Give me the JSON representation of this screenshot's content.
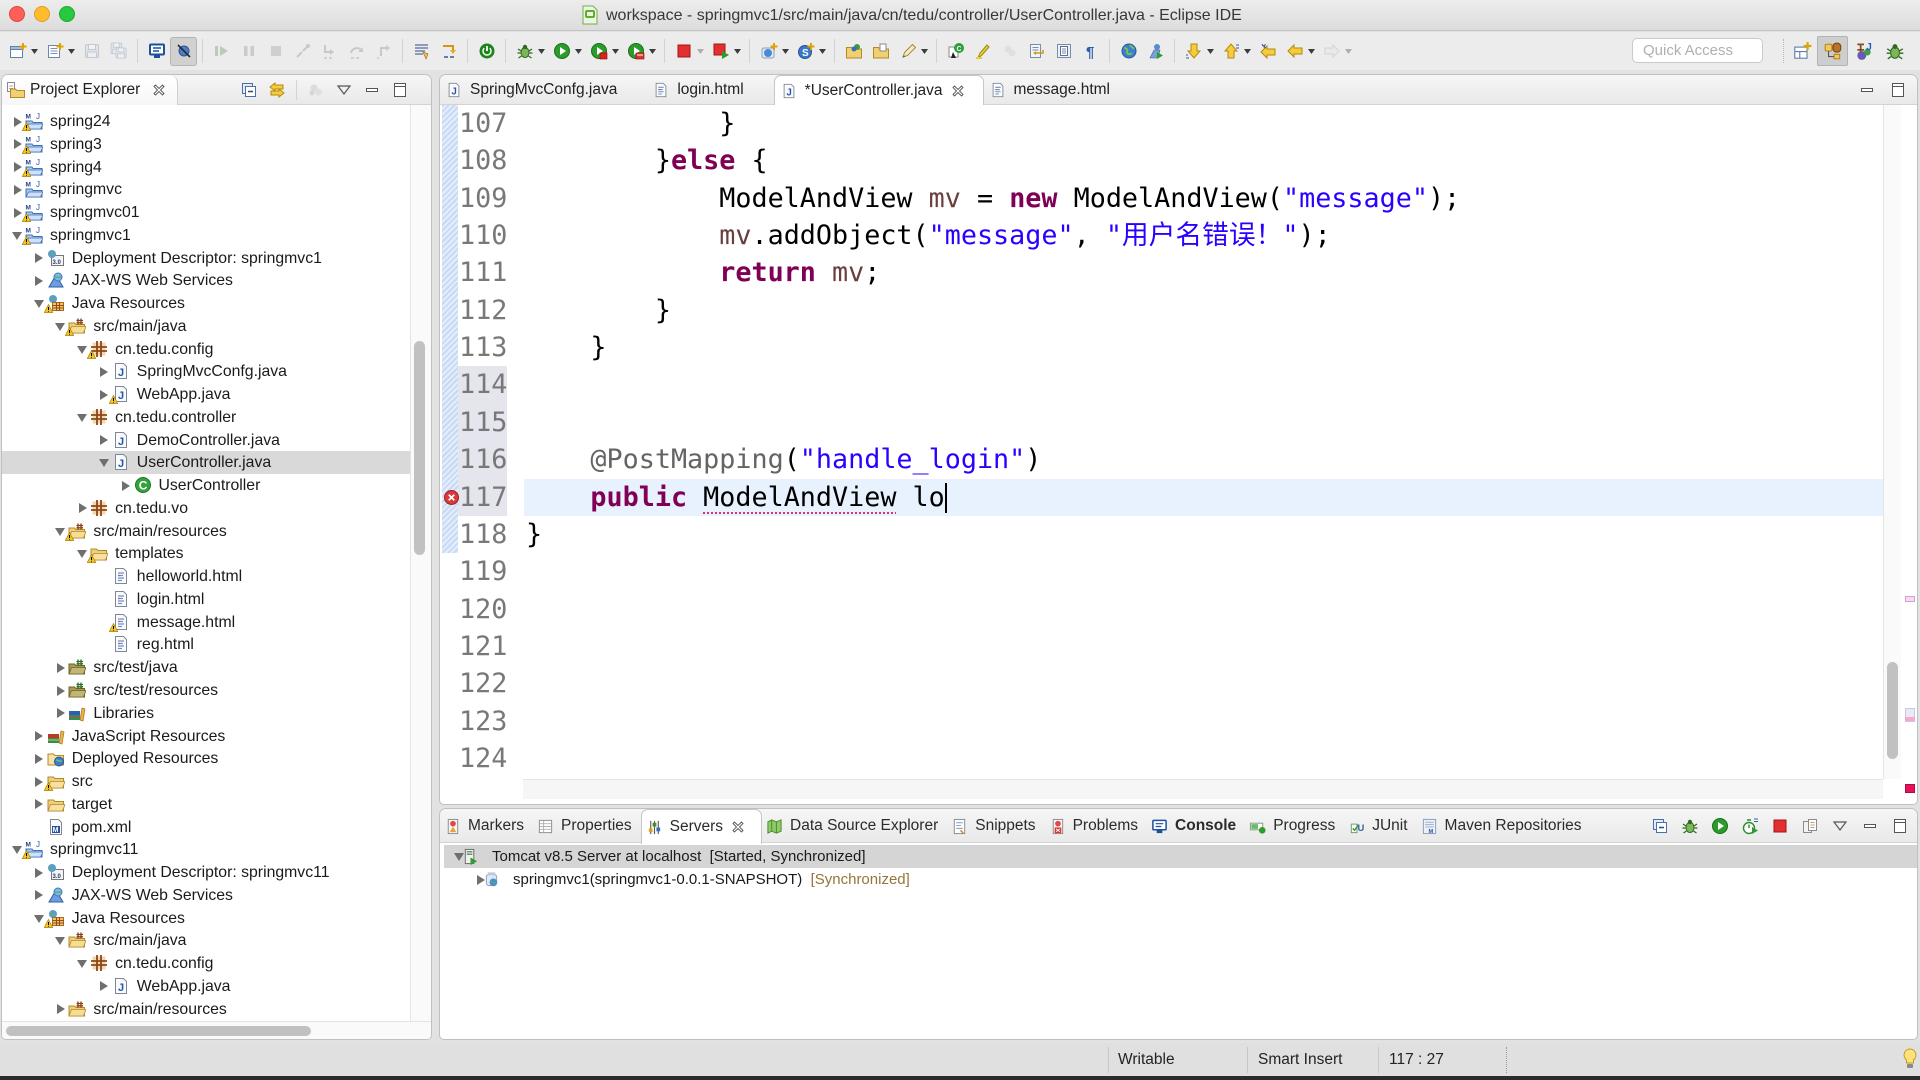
{
  "window": {
    "title": "workspace - springmvc1/src/main/java/cn/tedu/controller/UserController.java - Eclipse IDE",
    "title_icon": "eclipse-workspace"
  },
  "toolbar": {
    "buttons": [
      {
        "icon": "new-wizard",
        "dropdown": true
      },
      {
        "icon": "new-file",
        "dropdown": true
      },
      {
        "icon": "save",
        "disabled": true
      },
      {
        "icon": "save-all",
        "disabled": true
      },
      {
        "type": "separator"
      },
      {
        "icon": "display-view"
      },
      {
        "icon": "skip-all-breakpoints",
        "pressed": true
      },
      {
        "type": "separator"
      },
      {
        "icon": "resume",
        "disabled": true
      },
      {
        "icon": "suspend",
        "disabled": true
      },
      {
        "icon": "terminate",
        "disabled": true
      },
      {
        "icon": "disconnect",
        "disabled": true
      },
      {
        "icon": "step-into",
        "disabled": true
      },
      {
        "icon": "step-over",
        "disabled": true
      },
      {
        "icon": "step-return",
        "disabled": true
      },
      {
        "type": "separator"
      },
      {
        "icon": "use-step-filters"
      },
      {
        "icon": "drop-to-frame"
      },
      {
        "type": "separator"
      },
      {
        "icon": "spring-boot-dashboard"
      },
      {
        "type": "separator"
      },
      {
        "icon": "debug",
        "dropdown": true
      },
      {
        "icon": "run",
        "dropdown": true
      },
      {
        "icon": "coverage",
        "dropdown": true
      },
      {
        "icon": "external-tools",
        "dropdown": true
      },
      {
        "type": "separator"
      },
      {
        "icon": "stop-server",
        "dropdown": true,
        "dropdown_disabled": true
      },
      {
        "icon": "launch-server",
        "dropdown": true
      },
      {
        "type": "separator"
      },
      {
        "icon": "new-web-project",
        "dropdown": true
      },
      {
        "icon": "new-spring-starter",
        "dropdown": true
      },
      {
        "type": "separator"
      },
      {
        "icon": "open-type"
      },
      {
        "icon": "open-task"
      },
      {
        "icon": "search",
        "dropdown": true
      },
      {
        "type": "separator"
      },
      {
        "icon": "open-java-class"
      },
      {
        "icon": "toggle-mark-occurrences"
      },
      {
        "icon": "toggle-breadcrumb",
        "disabled": true
      },
      {
        "icon": "toggle-word-wrap"
      },
      {
        "icon": "toggle-block-selection"
      },
      {
        "icon": "show-whitespace"
      },
      {
        "type": "separator"
      },
      {
        "icon": "open-web-browser"
      },
      {
        "icon": "run-last-tool"
      },
      {
        "type": "separator"
      },
      {
        "icon": "next-annotation",
        "dropdown": true
      },
      {
        "icon": "previous-annotation",
        "dropdown": true
      },
      {
        "icon": "last-edit-location"
      },
      {
        "icon": "back",
        "dropdown": true
      },
      {
        "icon": "forward",
        "dropdown": true,
        "disabled": true
      }
    ],
    "quick_access_placeholder": "Quick Access",
    "perspectives": [
      {
        "icon": "open-perspective"
      },
      {
        "icon": "java-ee-perspective",
        "pressed": true
      },
      {
        "icon": "java-perspective"
      },
      {
        "icon": "debug-perspective"
      }
    ]
  },
  "explorer": {
    "title": "Project Explorer",
    "icon": "project-explorer",
    "tools": [
      {
        "icon": "collapse-all"
      },
      {
        "icon": "link-with-editor"
      },
      {
        "type": "separator"
      },
      {
        "icon": "filters",
        "disabled": true
      },
      {
        "icon": "view-menu"
      },
      {
        "icon": "minimize"
      },
      {
        "icon": "maximize"
      }
    ],
    "tree": [
      {
        "label": "spring24",
        "level": 0,
        "state": "collapsed",
        "icon": "maven-project",
        "warning": true
      },
      {
        "label": "spring3",
        "level": 0,
        "state": "collapsed",
        "icon": "maven-project",
        "warning": true
      },
      {
        "label": "spring4",
        "level": 0,
        "state": "collapsed",
        "icon": "maven-project",
        "warning": true
      },
      {
        "label": "springmvc",
        "level": 0,
        "state": "collapsed",
        "icon": "maven-project"
      },
      {
        "label": "springmvc01",
        "level": 0,
        "state": "collapsed",
        "icon": "maven-project",
        "warning": true
      },
      {
        "label": "springmvc1",
        "level": 0,
        "state": "expanded",
        "icon": "maven-project",
        "warning": true
      },
      {
        "label": "Deployment Descriptor: springmvc1",
        "level": 1,
        "state": "collapsed",
        "icon": "deployment-descriptor"
      },
      {
        "label": "JAX-WS Web Services",
        "level": 1,
        "state": "collapsed",
        "icon": "jax-ws"
      },
      {
        "label": "Java Resources",
        "level": 1,
        "state": "expanded",
        "icon": "java-resources",
        "warning": true
      },
      {
        "label": "src/main/java",
        "level": 2,
        "state": "expanded",
        "icon": "source-folder",
        "warning": true
      },
      {
        "label": "cn.tedu.config",
        "level": 3,
        "state": "expanded",
        "icon": "package",
        "warning": true
      },
      {
        "label": "SpringMvcConfg.java",
        "level": 4,
        "state": "collapsed",
        "icon": "java-file"
      },
      {
        "label": "WebApp.java",
        "level": 4,
        "state": "collapsed",
        "icon": "java-file",
        "warning": true
      },
      {
        "label": "cn.tedu.controller",
        "level": 3,
        "state": "expanded",
        "icon": "package"
      },
      {
        "label": "DemoController.java",
        "level": 4,
        "state": "collapsed",
        "icon": "java-file"
      },
      {
        "label": "UserController.java",
        "level": 4,
        "state": "expanded",
        "icon": "java-file",
        "selected": true
      },
      {
        "label": "UserController",
        "level": 5,
        "state": "collapsed",
        "icon": "class"
      },
      {
        "label": "cn.tedu.vo",
        "level": 3,
        "state": "collapsed",
        "icon": "package"
      },
      {
        "label": "src/main/resources",
        "level": 2,
        "state": "expanded",
        "icon": "source-folder",
        "warning": true
      },
      {
        "label": "templates",
        "level": 3,
        "state": "expanded",
        "icon": "folder",
        "warning": true
      },
      {
        "label": "helloworld.html",
        "level": 4,
        "state": "leaf",
        "icon": "html-file"
      },
      {
        "label": "login.html",
        "level": 4,
        "state": "leaf",
        "icon": "html-file"
      },
      {
        "label": "message.html",
        "level": 4,
        "state": "leaf",
        "icon": "html-file",
        "warning": true
      },
      {
        "label": "reg.html",
        "level": 4,
        "state": "leaf",
        "icon": "html-file"
      },
      {
        "label": "src/test/java",
        "level": 2,
        "state": "collapsed",
        "icon": "test-source-folder"
      },
      {
        "label": "src/test/resources",
        "level": 2,
        "state": "collapsed",
        "icon": "test-source-folder"
      },
      {
        "label": "Libraries",
        "level": 2,
        "state": "collapsed",
        "icon": "libraries"
      },
      {
        "label": "JavaScript Resources",
        "level": 1,
        "state": "collapsed",
        "icon": "javascript-resources"
      },
      {
        "label": "Deployed Resources",
        "level": 1,
        "state": "collapsed",
        "icon": "deployed-resources"
      },
      {
        "label": "src",
        "level": 1,
        "state": "collapsed",
        "icon": "folder",
        "warning": true
      },
      {
        "label": "target",
        "level": 1,
        "state": "collapsed",
        "icon": "folder"
      },
      {
        "label": "pom.xml",
        "level": 1,
        "state": "leaf",
        "icon": "pom-file"
      },
      {
        "label": "springmvc11",
        "level": 0,
        "state": "expanded",
        "icon": "maven-project",
        "warning": true
      },
      {
        "label": "Deployment Descriptor: springmvc11",
        "level": 1,
        "state": "collapsed",
        "icon": "deployment-descriptor"
      },
      {
        "label": "JAX-WS Web Services",
        "level": 1,
        "state": "collapsed",
        "icon": "jax-ws"
      },
      {
        "label": "Java Resources",
        "level": 1,
        "state": "expanded",
        "icon": "java-resources",
        "warning": true
      },
      {
        "label": "src/main/java",
        "level": 2,
        "state": "expanded",
        "icon": "source-folder"
      },
      {
        "label": "cn.tedu.config",
        "level": 3,
        "state": "expanded",
        "icon": "package"
      },
      {
        "label": "WebApp.java",
        "level": 4,
        "state": "collapsed",
        "icon": "java-file"
      },
      {
        "label": "src/main/resources",
        "level": 2,
        "state": "collapsed",
        "icon": "source-folder"
      }
    ],
    "vscroll": {
      "position": 0.258,
      "size": 0.233
    },
    "hscroll": {
      "position": 0.01,
      "size": 0.745
    }
  },
  "editor": {
    "tabs": [
      {
        "label": "SpringMvcConfg.java",
        "icon": "java-file"
      },
      {
        "label": "login.html",
        "icon": "html-file"
      },
      {
        "label": "*UserController.java",
        "icon": "java-file",
        "active": true,
        "dirty": true
      },
      {
        "label": "message.html",
        "icon": "html-file"
      }
    ],
    "tools": [
      {
        "icon": "minimize"
      },
      {
        "icon": "maximize"
      }
    ],
    "current_line": 117,
    "error_lines": [
      117
    ],
    "quick_diff": {
      "changed": [
        107,
        118
      ],
      "added": [
        114,
        117
      ]
    },
    "lines": [
      {
        "n": "107",
        "tokens": [
          [
            "\t\t\t}",
            "plain"
          ]
        ]
      },
      {
        "n": "108",
        "tokens": [
          [
            "\t\t}",
            "plain"
          ],
          [
            "else",
            "kw"
          ],
          [
            " {",
            "plain"
          ]
        ]
      },
      {
        "n": "109",
        "tokens": [
          [
            "\t\t\tModelAndView ",
            "plain"
          ],
          [
            "mv",
            "var"
          ],
          [
            " = ",
            "plain"
          ],
          [
            "new",
            "kw"
          ],
          [
            " ModelAndView(",
            "plain"
          ],
          [
            "\"message\"",
            "str"
          ],
          [
            ");",
            "plain"
          ]
        ]
      },
      {
        "n": "110",
        "tokens": [
          [
            "\t\t\t",
            "plain"
          ],
          [
            "mv",
            "var"
          ],
          [
            ".addObject(",
            "plain"
          ],
          [
            "\"message\"",
            "str"
          ],
          [
            ", ",
            "plain"
          ],
          [
            "\"用户名错误！\"",
            "str"
          ],
          [
            ");",
            "plain"
          ]
        ]
      },
      {
        "n": "111",
        "tokens": [
          [
            "\t\t\t",
            "plain"
          ],
          [
            "return",
            "kw"
          ],
          [
            " ",
            "plain"
          ],
          [
            "mv",
            "var"
          ],
          [
            ";",
            "plain"
          ]
        ]
      },
      {
        "n": "112",
        "tokens": [
          [
            "\t\t}",
            "plain"
          ]
        ]
      },
      {
        "n": "113",
        "tokens": [
          [
            "\t}",
            "plain"
          ]
        ]
      },
      {
        "n": "114",
        "tokens": []
      },
      {
        "n": "115",
        "tokens": []
      },
      {
        "n": "116",
        "tokens": [
          [
            "\t",
            "plain"
          ],
          [
            "@PostMapping",
            "ann"
          ],
          [
            "(",
            "plain"
          ],
          [
            "\"handle_login\"",
            "str"
          ],
          [
            ")",
            "plain"
          ]
        ]
      },
      {
        "n": "117",
        "tokens": [
          [
            "\t",
            "plain"
          ],
          [
            "public",
            "kw"
          ],
          [
            " ",
            "plain"
          ],
          [
            "ModelAndView",
            "error"
          ],
          [
            " lo",
            "plain"
          ]
        ]
      },
      {
        "n": "118",
        "tokens": [
          [
            "}",
            "plain"
          ]
        ]
      },
      {
        "n": "119",
        "tokens": []
      },
      {
        "n": "120",
        "tokens": []
      },
      {
        "n": "121",
        "tokens": []
      },
      {
        "n": "122",
        "tokens": []
      },
      {
        "n": "123",
        "tokens": []
      },
      {
        "n": "124",
        "tokens": []
      }
    ],
    "vscroll": {
      "position": 0.826,
      "size": 0.145
    }
  },
  "bottom_panel": {
    "tabs": [
      {
        "label": "Markers",
        "icon": "markers"
      },
      {
        "label": "Properties",
        "icon": "properties"
      },
      {
        "label": "Servers",
        "icon": "servers",
        "active": true
      },
      {
        "label": "Data Source Explorer",
        "icon": "data-source"
      },
      {
        "label": "Snippets",
        "icon": "snippets"
      },
      {
        "label": "Problems",
        "icon": "problems"
      },
      {
        "label": "Console",
        "icon": "console",
        "bold": true
      },
      {
        "label": "Progress",
        "icon": "progress"
      },
      {
        "label": "JUnit",
        "icon": "junit"
      },
      {
        "label": "Maven Repositories",
        "icon": "maven-repositories"
      }
    ],
    "tools": [
      {
        "icon": "collapse-all"
      },
      {
        "icon": "debug-server"
      },
      {
        "icon": "start-server"
      },
      {
        "icon": "profile-server"
      },
      {
        "icon": "stop-server"
      },
      {
        "icon": "publish"
      },
      {
        "icon": "view-menu"
      },
      {
        "icon": "minimize"
      },
      {
        "icon": "maximize"
      }
    ],
    "servers": [
      {
        "label": "Tomcat v8.5 Server at localhost",
        "status": "  [Started, Synchronized]",
        "level": 0,
        "state": "expanded",
        "icon": "tomcat-server",
        "selected": true,
        "status_plain": true
      },
      {
        "label": "springmvc1(springmvc1-0.0.1-SNAPSHOT)",
        "status": "  [Synchronized]",
        "level": 1,
        "state": "collapsed",
        "icon": "web-module"
      }
    ]
  },
  "status_bar": {
    "writable": "Writable",
    "insert_mode": "Smart Insert",
    "cursor_position": "117 : 27"
  }
}
